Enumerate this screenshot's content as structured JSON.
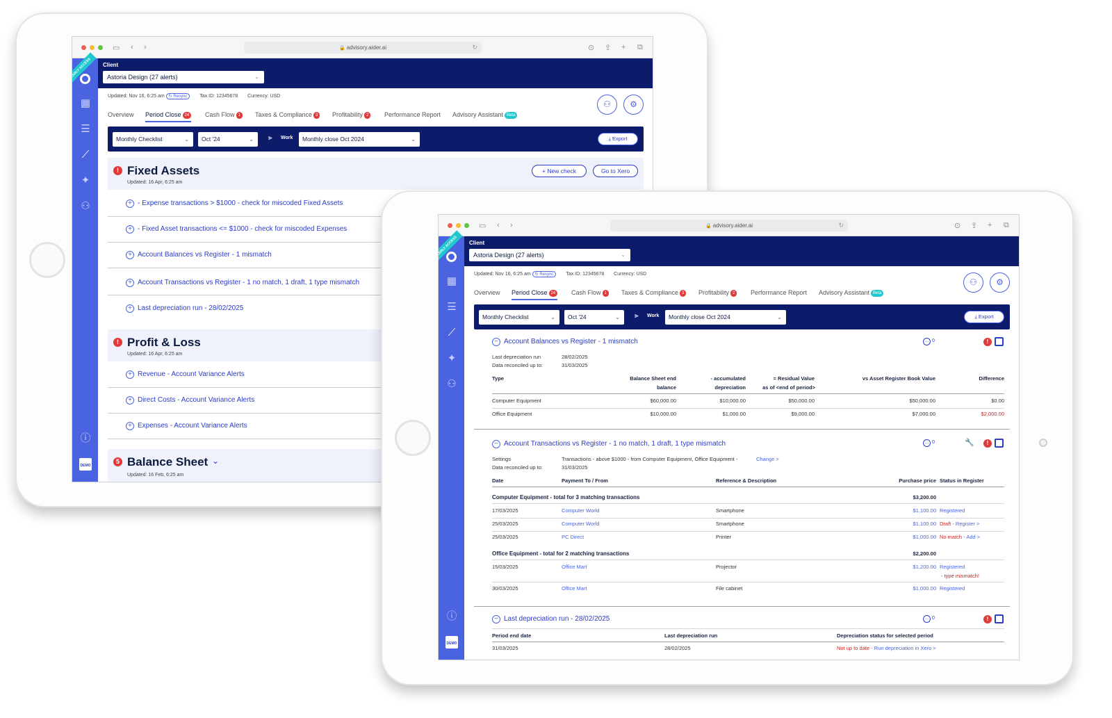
{
  "browser": {
    "url": "advisory.aider.ai"
  },
  "sidebar": {
    "ribbon": "EARLY ACCESS",
    "demo": "DEMO"
  },
  "client": {
    "label": "Client",
    "selected": "Astoria Design (27 alerts)"
  },
  "meta": {
    "updated": "Updated: Nov 16, 6:25 am",
    "resync": "Resync",
    "tax_id": "Tax ID: 12345678",
    "currency": "Currency: USD"
  },
  "tabs": [
    {
      "label": "Overview",
      "badge": ""
    },
    {
      "label": "Period Close",
      "badge": "24"
    },
    {
      "label": "Cash Flow",
      "badge": "1"
    },
    {
      "label": "Taxes & Compliance",
      "badge": "3"
    },
    {
      "label": "Profitability",
      "badge": "2"
    },
    {
      "label": "Performance Report",
      "badge": ""
    },
    {
      "label": "Advisory Assistant",
      "badge": "Beta"
    }
  ],
  "toolbar": {
    "checklist": "Monthly Checklist",
    "period": "Oct '24",
    "work_label": "Work",
    "work_value": "Monthly close Oct 2024",
    "export": "Export"
  },
  "back": {
    "fixed_assets": {
      "title": "Fixed Assets",
      "updated": "Updated: 16 Apr, 6:25 am",
      "new_check": "New check",
      "go_xero": "Go to Xero",
      "alert": "!",
      "checks": [
        "- Expense transactions > $1000 - check for miscoded Fixed Assets",
        "- Fixed Asset transactions <= $1000 - check for miscoded Expenses",
        "Account Balances vs Register - 1 mismatch",
        "Account Transactions vs Register - 1 no match, 1 draft, 1 type mismatch",
        "Last depreciation run - 28/02/2025"
      ]
    },
    "pnl": {
      "title": "Profit & Loss",
      "updated": "Updated: 16 Apr, 6:25 am",
      "alert": "!",
      "checks": [
        "Revenue - Account Variance Alerts",
        "Direct Costs - Account Variance Alerts",
        "Expenses - Account Variance Alerts"
      ]
    },
    "balance": {
      "title": "Balance Sheet",
      "updated": "Updated: 16 Feb, 6:25 am",
      "alert": "5"
    }
  },
  "front": {
    "balances": {
      "title": "Account Balances vs Register - 1 mismatch",
      "comments": "0",
      "last_dep_label": "Last depreciation run",
      "last_dep_value": "28/02/2025",
      "reconciled_label": "Data reconciled up to:",
      "reconciled_value": "31/03/2025",
      "headers": [
        "Type",
        "Balance Sheet end",
        "balance",
        "- accumulated",
        "depreciation",
        "= Residual Value",
        "as of <end of period>",
        "vs Asset Register Book Value",
        "Difference"
      ],
      "rows": [
        {
          "type": "Computer Equipment",
          "bs": "$60,000.00",
          "acc": "$10,000.00",
          "res": "$50,000.00",
          "reg": "$50,000.00",
          "diff": "$0.00"
        },
        {
          "type": "Office Equipment",
          "bs": "$10,000.00",
          "acc": "$1,000.00",
          "res": "$9,000.00",
          "reg": "$7,000.00",
          "diff": "$2,000.00"
        }
      ]
    },
    "transactions": {
      "title": "Account Transactions vs Register - 1 no match, 1 draft, 1 type mismatch",
      "comments": "0",
      "settings_label": "Settings",
      "settings_value": "Transactions - above $1000 - from Computer Equipment, Office Equipment -",
      "change": "Change >",
      "reconciled_label": "Data reconciled up to:",
      "reconciled_value": "31/03/2025",
      "headers": [
        "Date",
        "Payment To / From",
        "Reference & Description",
        "Purchase price",
        "Status in Register"
      ],
      "group1": {
        "title": "Computer Equipment - total for 3 matching transactions",
        "total": "$3,200.00"
      },
      "group1_rows": [
        {
          "date": "17/03/2025",
          "payee": "Computer World",
          "desc": "Smartphone",
          "price": "$1,100.00",
          "status": "Registered",
          "action": ""
        },
        {
          "date": "25/03/2025",
          "payee": "Computer World",
          "desc": "Smartphone",
          "price": "$1,100.00",
          "status": "Draft",
          "action": " - Register >"
        },
        {
          "date": "25/03/2025",
          "payee": "PC Direct",
          "desc": "Printer",
          "price": "$1,000.00",
          "status": "No match",
          "action": " - Add >"
        }
      ],
      "group2": {
        "title": "Office Equipment - total for 2 matching transactions",
        "total": "$2,200.00"
      },
      "group2_rows": [
        {
          "date": "15/03/2025",
          "payee": "Office Mart",
          "desc": "Projector",
          "price": "$1,200.00",
          "status": "Registered",
          "note": "- type mismatch!"
        },
        {
          "date": "30/03/2025",
          "payee": "Office Mart",
          "desc": "File cabinet",
          "price": "$1,000.00",
          "status": "Registered",
          "note": ""
        }
      ]
    },
    "depreciation": {
      "title": "Last depreciation run - 28/02/2025",
      "comments": "0",
      "headers": [
        "Period end date",
        "Last depreciation run",
        "Depreciation status for selected period"
      ],
      "row": {
        "period": "31/03/2025",
        "last": "28/02/2025",
        "status": "Not up to date",
        "action": " - Run depreciation in Xero >"
      }
    }
  }
}
